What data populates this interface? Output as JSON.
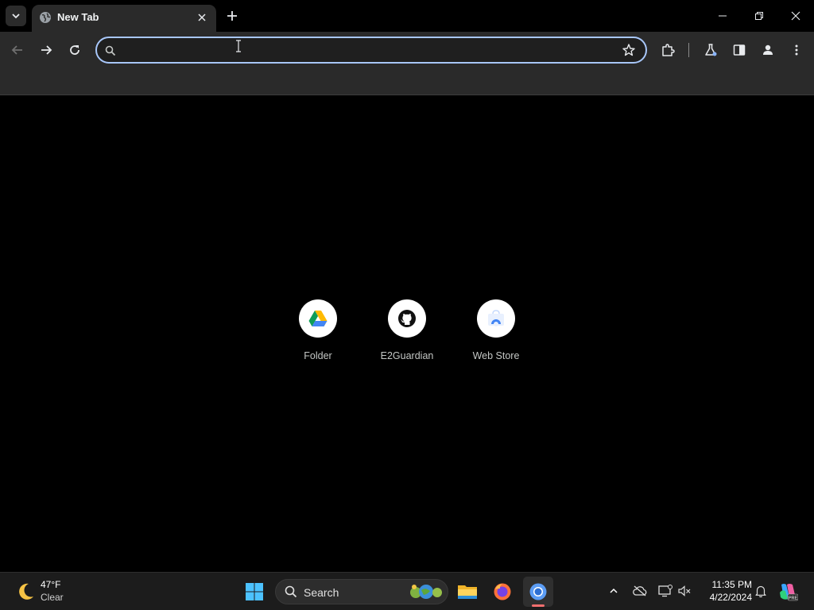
{
  "browser": {
    "tab": {
      "title": "New Tab"
    },
    "omnibox": {
      "value": "",
      "placeholder": ""
    }
  },
  "shortcuts": [
    {
      "label": "Folder",
      "icon": "google-drive-icon"
    },
    {
      "label": "E2Guardian",
      "icon": "github-icon"
    },
    {
      "label": "Web Store",
      "icon": "web-store-icon"
    }
  ],
  "taskbar": {
    "weather": {
      "temp": "47°F",
      "condition": "Clear",
      "icon": "moon-icon"
    },
    "search_label": "Search",
    "time": "11:35 PM",
    "date": "4/22/2024"
  },
  "colors": {
    "accent": "#a8c7fa",
    "tab_bg": "#2a2a2a",
    "page_bg": "#000000",
    "taskbar_bg": "#1c1c1c",
    "active_indicator": "#f36f6f"
  }
}
